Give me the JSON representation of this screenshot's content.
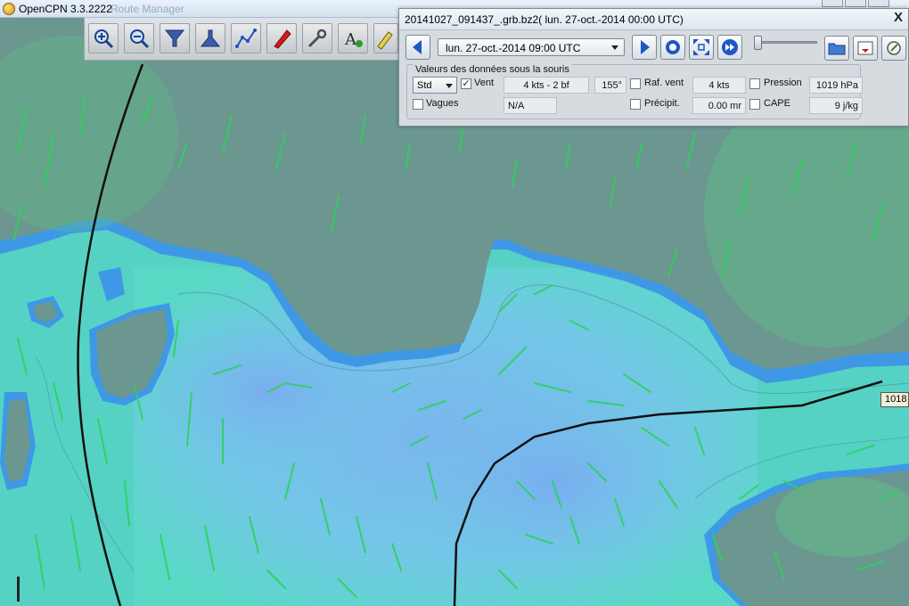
{
  "window": {
    "title": "OpenCPN 3.3.2222",
    "ghost_title": "Route Manager"
  },
  "toolbar": {
    "buttons": [
      {
        "name": "zoom-in",
        "icon": "zoom-in-icon"
      },
      {
        "name": "zoom-out",
        "icon": "zoom-out-icon"
      },
      {
        "name": "scale-in",
        "icon": "funnel-down-icon"
      },
      {
        "name": "scale-out",
        "icon": "funnel-up-icon"
      },
      {
        "name": "route",
        "icon": "route-icon"
      },
      {
        "name": "boat",
        "icon": "boat-icon"
      },
      {
        "name": "settings",
        "icon": "wrench-icon"
      },
      {
        "name": "text",
        "icon": "text-a-icon"
      },
      {
        "name": "tide",
        "icon": "pencil-icon"
      }
    ]
  },
  "grib": {
    "title": "20141027_091437_.grb.bz2( lun. 27-oct.-2014 00:00  UTC)",
    "close_glyph": "X",
    "time_selected": "lun. 27-oct.-2014 09:00  UTC",
    "values_title": "Valeurs des données sous la souris",
    "std_value": "Std",
    "fields": {
      "vent_label": "Vent",
      "vent_checked": true,
      "vent_speed": "4 kts -  2 bf",
      "vent_dir": "155°",
      "rafales_label": "Raf. vent",
      "rafales_checked": false,
      "rafales_value": "4 kts",
      "pression_label": "Pression",
      "pression_checked": false,
      "pression_value": "1019 hPa",
      "vagues_label": "Vagues",
      "vagues_checked": false,
      "vagues_value": "N/A",
      "precip_label": "Précipit.",
      "precip_checked": false,
      "precip_value": "0.00 mr",
      "cape_label": "CAPE",
      "cape_checked": false,
      "cape_value": "9 j/kg"
    },
    "check_glyph": "✓"
  },
  "chart": {
    "route_label": "1018",
    "colors": {
      "land": "#6c9690",
      "shallow_blue": "#3e98e6",
      "sea_light": "#6fd6d6",
      "sea_blue": "#7ab6ee",
      "wind": "#2fd15c",
      "route": "#111111"
    }
  }
}
